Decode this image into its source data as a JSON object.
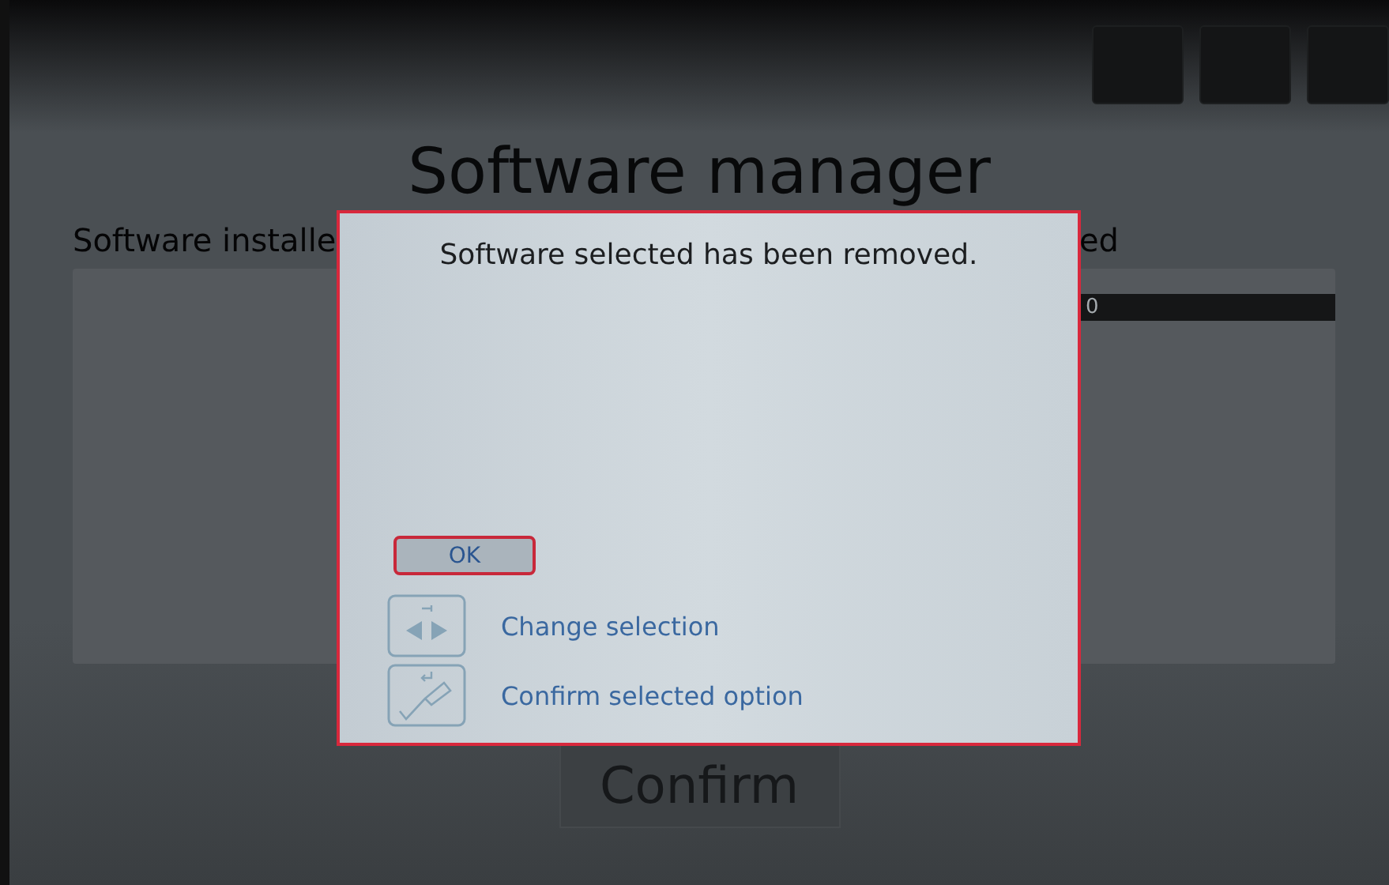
{
  "background": {
    "title": "Software manager",
    "left_label": "Software installe",
    "right_label": "ed",
    "list_row": "0",
    "confirm_button": "Confirm"
  },
  "dialog": {
    "message": "Software selected has been removed.",
    "ok_button": {
      "label": "OK",
      "selected": true
    },
    "hints": [
      {
        "kind": "navigate",
        "label": "Change selection"
      },
      {
        "kind": "confirm",
        "label": "Confirm selected option"
      }
    ]
  }
}
